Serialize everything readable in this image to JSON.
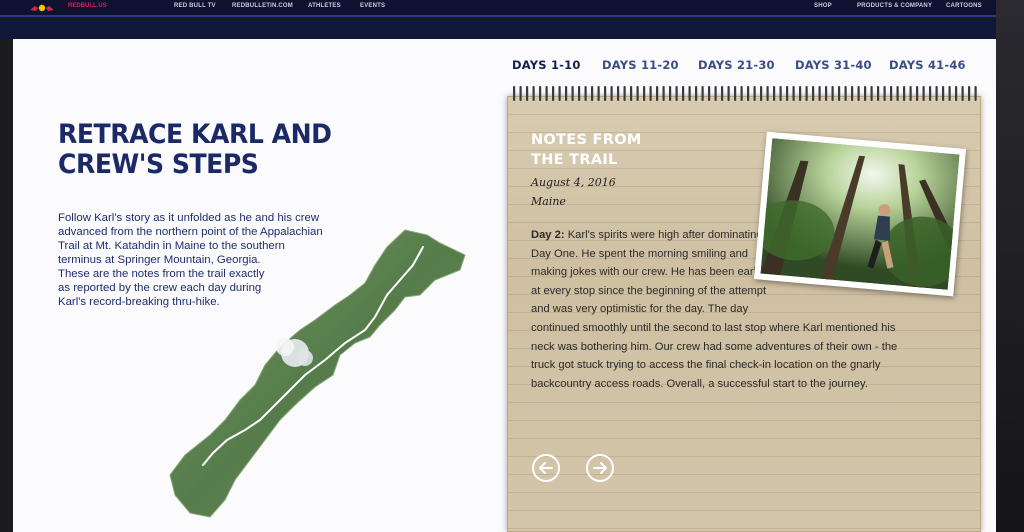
{
  "nav": {
    "brand": "REDBULL.US",
    "links": [
      "RED BULL TV",
      "REDBULLETIN.COM",
      "ATHLETES",
      "EVENTS"
    ],
    "right_links": [
      "SHOP",
      "PRODUCTS & COMPANY",
      "CARTOONS"
    ]
  },
  "hero": {
    "title_line1": "RETRACE KARL AND",
    "title_line2": "CREW'S STEPS",
    "intro_lines": [
      "Follow Karl's story as it unfolded as he and his crew",
      "advanced from the northern point of the Appalachian",
      "Trail at Mt. Katahdin in Maine to the southern",
      "terminus at Springer Mountain, Georgia.",
      "These are the notes from the trail exactly",
      "as reported by the crew each day during",
      "Karl's record-breaking thru-hike."
    ]
  },
  "tabs": [
    "DAYS 1-10",
    "DAYS 11-20",
    "DAYS 21-30",
    "DAYS 31-40",
    "DAYS 41-46"
  ],
  "active_tab": "DAYS 1-10",
  "notes": {
    "title_line1": "NOTES FROM",
    "title_line2": "THE TRAIL",
    "date": "August 4, 2016",
    "place": "Maine",
    "day_label": "Day 2:",
    "body_lines": [
      " Karl's spirits were high after dominating",
      "Day One. He spent the morning smiling and",
      "making jokes with our crew. He has been early",
      "at every stop since the beginning of the attempt",
      "and was very optimistic for the day. The day",
      "continued smoothly until the second to last stop where Karl mentioned his",
      "neck was bothering him. Our crew had some adventures of their own - the",
      "truck got stuck trying to access the final check-in location on the gnarly",
      "backcountry access roads. Overall, a successful start to the journey."
    ]
  },
  "colors": {
    "brand_red": "#d0264a",
    "headline_navy": "#1b2a66",
    "nav_bg": "#0e1230",
    "paper": "#d2c5a9"
  },
  "icons": {
    "prev": "arrow-left-circle-icon",
    "next": "arrow-right-circle-icon"
  }
}
